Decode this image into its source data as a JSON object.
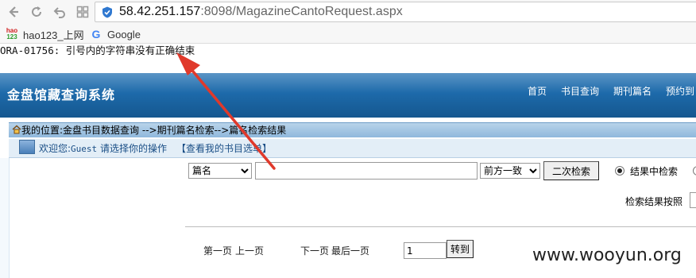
{
  "browser": {
    "url_host": "58.42.251.157",
    "url_rest": ":8098/MagazineCantoRequest.aspx",
    "bookmarks": [
      {
        "label": "hao123_上网",
        "icon": "hao123-icon",
        "icon_text_top": "hao",
        "icon_text_bottom": "123"
      },
      {
        "label": "Google",
        "icon": "google-icon",
        "icon_text": "G"
      }
    ]
  },
  "error_message": "ORA-01756: 引号内的字符串没有正确结束",
  "header": {
    "site_title": "金盘馆藏查询系统",
    "nav": [
      "首页",
      "书目查询",
      "期刊篇名",
      "预约到"
    ]
  },
  "breadcrumb": "我的位置:金盘书目数据查询 -->期刊篇名检索-->篇名检索结果",
  "welcome": {
    "prefix": "欢迎您:",
    "user": "Guest",
    "prompt": " 请选择你的操作",
    "my_bib_link": "【查看我的书目选单】"
  },
  "search": {
    "field_selected": "篇名",
    "keyword_value": "",
    "match_selected": "前方一致",
    "secondary_search_button": "二次检索",
    "radio_in_results": "结果中检索",
    "sort_label": "检索结果按照"
  },
  "pagination": {
    "first": "第一页",
    "prev": "上一页",
    "next": "下一页",
    "last": "最后一页",
    "page_value": "1",
    "go_button": "转到"
  },
  "watermark": "www.wooyun.org",
  "colors": {
    "header_dark": "#15578f",
    "header_light": "#5b95c6",
    "annotation_arrow": "#e0392b"
  }
}
